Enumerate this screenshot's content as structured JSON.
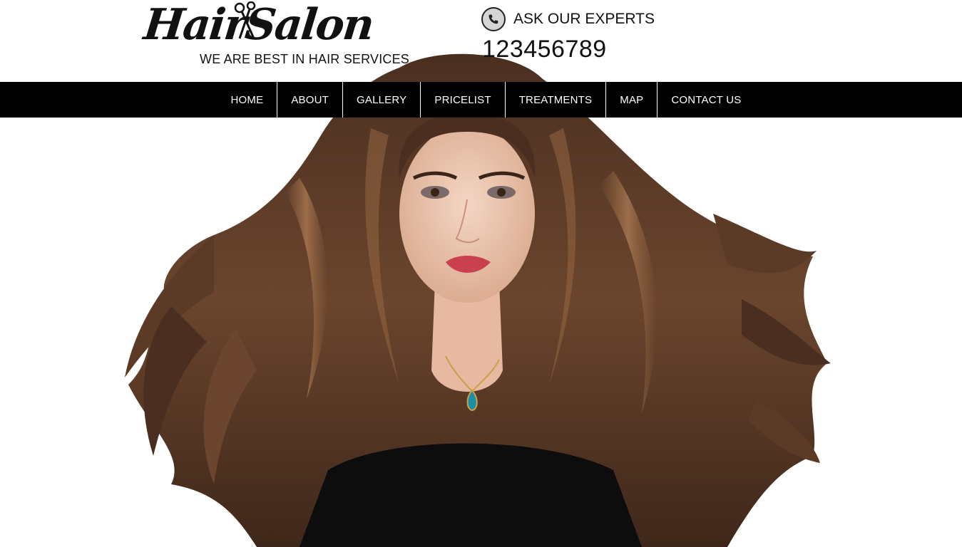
{
  "brand": {
    "logo_text": "HairSalon",
    "tagline": "WE ARE BEST IN HAIR SERVICES",
    "logo_icon": "scissors-icon"
  },
  "contact": {
    "icon": "phone-icon",
    "label": "ASK OUR EXPERTS",
    "phone": "123456789"
  },
  "nav": {
    "items": [
      {
        "label": "HOME"
      },
      {
        "label": "ABOUT"
      },
      {
        "label": "GALLERY"
      },
      {
        "label": "PRICELIST"
      },
      {
        "label": "TREATMENTS"
      },
      {
        "label": "MAP"
      },
      {
        "label": "CONTACT US"
      }
    ]
  },
  "hero": {
    "image": "woman-with-long-flowing-brown-hair"
  },
  "colors": {
    "nav_background": "#000000",
    "nav_text": "#ffffff",
    "page_background": "#ffffff",
    "hair": "#5a3a26"
  }
}
